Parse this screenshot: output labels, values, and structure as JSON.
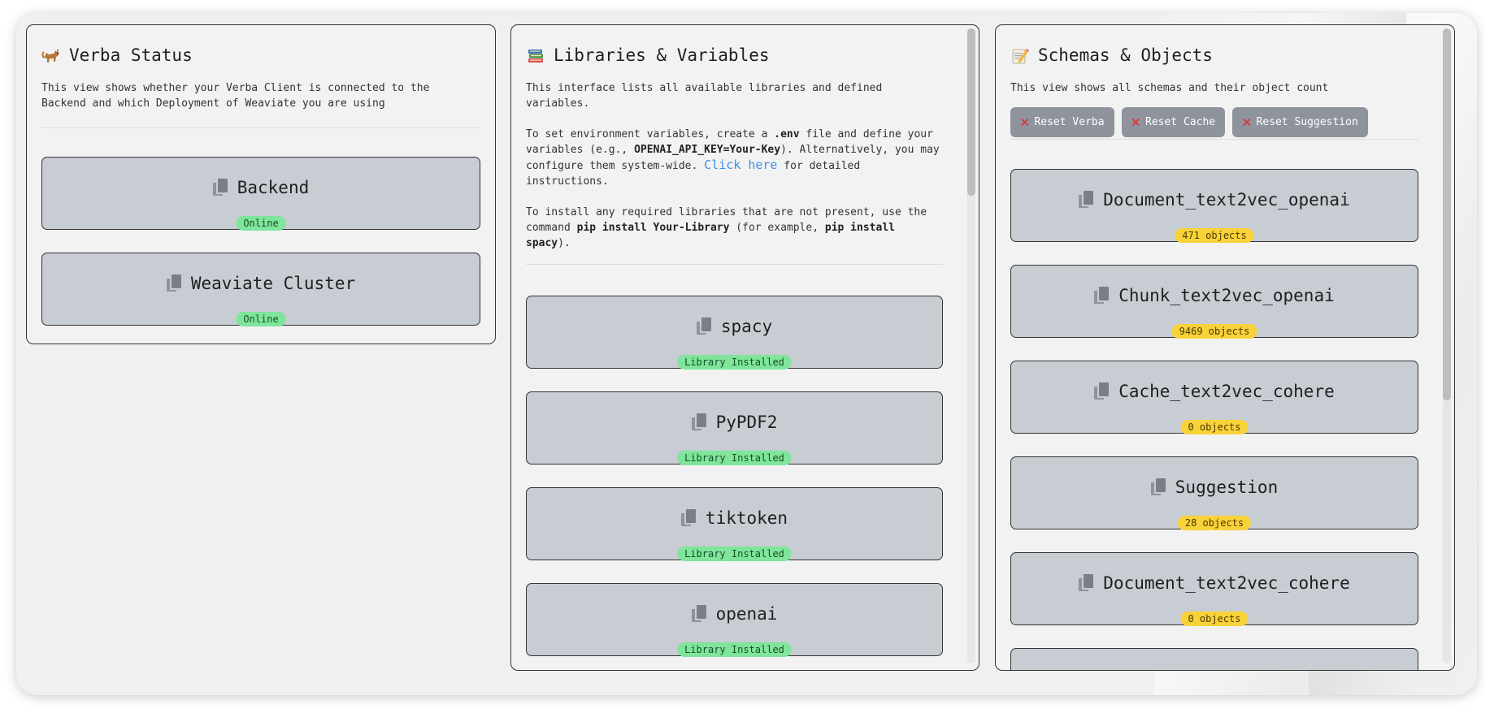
{
  "status_panel": {
    "title": "Verba Status",
    "title_icon": "cat-emoji-icon",
    "description": "This view shows whether your Verba Client is connected to the Backend and which Deployment of Weaviate you are using",
    "items": [
      {
        "label": "Backend",
        "status": "Online"
      },
      {
        "label": "Weaviate Cluster",
        "status": "Online"
      }
    ]
  },
  "libraries_panel": {
    "title": "Libraries & Variables",
    "title_icon": "books-emoji-icon",
    "intro": "This interface lists all available libraries and defined variables.",
    "env_text_1": "To set environment variables, create a ",
    "env_file": ".env",
    "env_text_2": " file and define your variables (e.g., ",
    "env_example": "OPENAI_API_KEY=Your-Key",
    "env_text_3": "). Alternatively, you may configure them system-wide. ",
    "link_text": "Click here",
    "env_text_4": " for detailed instructions.",
    "install_text_1": "To install any required libraries that are not present, use the command ",
    "install_cmd": "pip install Your-Library",
    "install_text_2": " (for example, ",
    "install_example": "pip install spacy",
    "install_text_3": ").",
    "libraries": [
      {
        "name": "spacy",
        "status": "Library Installed"
      },
      {
        "name": "PyPDF2",
        "status": "Library Installed"
      },
      {
        "name": "tiktoken",
        "status": "Library Installed"
      },
      {
        "name": "openai",
        "status": "Library Installed"
      }
    ]
  },
  "schemas_panel": {
    "title": "Schemas & Objects",
    "title_icon": "memo-emoji-icon",
    "description": "This view shows all schemas and their object count",
    "buttons": {
      "reset_verba": "Reset Verba",
      "reset_cache": "Reset Cache",
      "reset_suggestion": "Reset Suggestion"
    },
    "schemas": [
      {
        "name": "Document_text2vec_openai",
        "count": "471 objects"
      },
      {
        "name": "Chunk_text2vec_openai",
        "count": "9469 objects"
      },
      {
        "name": "Cache_text2vec_cohere",
        "count": "0 objects"
      },
      {
        "name": "Suggestion",
        "count": "28 objects"
      },
      {
        "name": "Document_text2vec_cohere",
        "count": "0 objects"
      }
    ]
  },
  "colors": {
    "card_bg": "#c8ccd3",
    "online_badge": "#7ee59b",
    "count_badge": "#f8d239",
    "reset_button": "#8e939c",
    "link": "#3d8fe6"
  }
}
